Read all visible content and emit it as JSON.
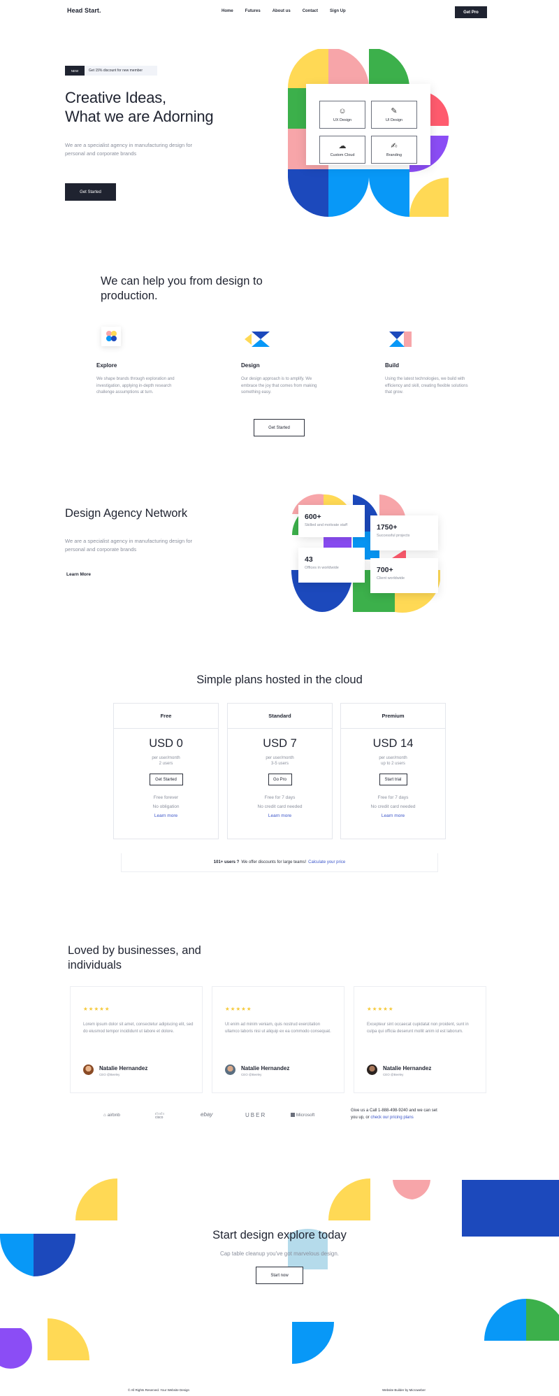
{
  "nav": {
    "logo": "Head Start.",
    "links": [
      "Home",
      "Futures",
      "About us",
      "Contact",
      "Sign Up"
    ],
    "cta": "Get Pro"
  },
  "hero": {
    "badge": "NEW",
    "promo": "Get 15% discount for new member",
    "title_line1": "Creative Ideas,",
    "title_line2": "What we are Adorning",
    "subtitle": "We are a specialist agency in manufacturing design for personal and corporate brands",
    "button": "Get Started",
    "services": [
      {
        "label": "UX Design",
        "icon": "ux-design-icon",
        "glyph": "☺"
      },
      {
        "label": "UI Design",
        "icon": "ui-design-icon",
        "glyph": "✎"
      },
      {
        "label": "Custom Cloud",
        "icon": "cloud-icon",
        "glyph": "☁"
      },
      {
        "label": "Branding",
        "icon": "branding-icon",
        "glyph": "✍"
      }
    ]
  },
  "help": {
    "title": "We can help you from design to production.",
    "features": [
      {
        "title": "Explore",
        "text": "We shape brands through exploration and investigation, applying in-depth research challenge assumptions at turn.",
        "icon": "explore-icon"
      },
      {
        "title": "Design",
        "text": "Our design approach is to amplify. We embrace the joy that comes from making something easy.",
        "icon": "design-icon"
      },
      {
        "title": "Build",
        "text": "Using the latest technologies, we build with efficiency and skill, creating flexible solutions that grow.",
        "icon": "build-icon"
      }
    ],
    "button": "Get Started"
  },
  "network": {
    "title": "Design Agency Network",
    "subtitle": "We are a specialist agency in manufacturing design for personal and corporate brands",
    "link": "Learn More",
    "stats": [
      {
        "num": "600+",
        "cap": "Skilled and motivate staff"
      },
      {
        "num": "1750+",
        "cap": "Successful projects"
      },
      {
        "num": "43",
        "cap": "Offices in worldwide"
      },
      {
        "num": "700+",
        "cap": "Client worldwide"
      }
    ]
  },
  "pricing": {
    "title": "Simple plans hosted in the cloud",
    "plans": [
      {
        "name": "Free",
        "price": "USD 0",
        "per1": "per user/month",
        "per2": "2 users",
        "button": "Get Started",
        "feat1": "Free forever",
        "feat2": "No obligation",
        "link": "Learn more"
      },
      {
        "name": "Standard",
        "price": "USD 7",
        "per1": "per user/month",
        "per2": "3-5 users",
        "button": "Go Pro",
        "feat1": "Free for 7 days",
        "feat2": "No credit card needed",
        "link": "Learn more"
      },
      {
        "name": "Premium",
        "price": "USD 14",
        "per1": "per user/month",
        "per2": "up to 2 users",
        "button": "Start trial",
        "feat1": "Free for 7 days",
        "feat2": "No credit card needed",
        "link": "Learn more"
      }
    ],
    "discount_bold": "101+ users ?",
    "discount_text": "We offer discounts for large teams!",
    "discount_link": "Calculate your price"
  },
  "testimonials": {
    "title": "Loved by businesses, and individuals",
    "stars": "★★★★★",
    "cards": [
      {
        "quote": "Lorem ipsum dolor sit amet, consectetur adipiscing elit, sed do eiusmod tempor incididunt ut labore et dolore.",
        "name": "Natalie Hernandez",
        "role": "CEO @Beeley"
      },
      {
        "quote": "Ut enim ad minim veniam, quis nostrud exercitation ullamco laboris nisi ut aliquip ex ea commodo consequat.",
        "name": "Natalie Hernandez",
        "role": "CEO @Beeley"
      },
      {
        "quote": "Excepteur sint occaecat cupidatat non proident, sunt in culpa qui officia deserunt mollit anim id est laborum.",
        "name": "Natalie Hernandez",
        "role": "CEO @Beeley"
      }
    ]
  },
  "brands": [
    "airbnb",
    "cisco",
    "ebay",
    "UBER",
    "Microsoft"
  ],
  "callus": {
    "text": "Give us a Call 1-888-498-9240 and we can set you up, or",
    "link": "check our pricing plans"
  },
  "cta": {
    "title": "Start design explore today",
    "subtitle": "Cap table cleanup you've got marvelous design.",
    "button": "Start now"
  },
  "footer": {
    "left": "© All Rights Reserved. Your Website Design",
    "right": "Website Builder by Microweber"
  },
  "colors": {
    "dark": "#1f2330",
    "yellow": "#ffd955",
    "pink": "#f7a5a9",
    "green": "#3cb04b",
    "red": "#ff5b6e",
    "purple": "#8b4df5",
    "blue": "#0898f7",
    "navy": "#1c49bc",
    "link": "#3b55c9"
  }
}
